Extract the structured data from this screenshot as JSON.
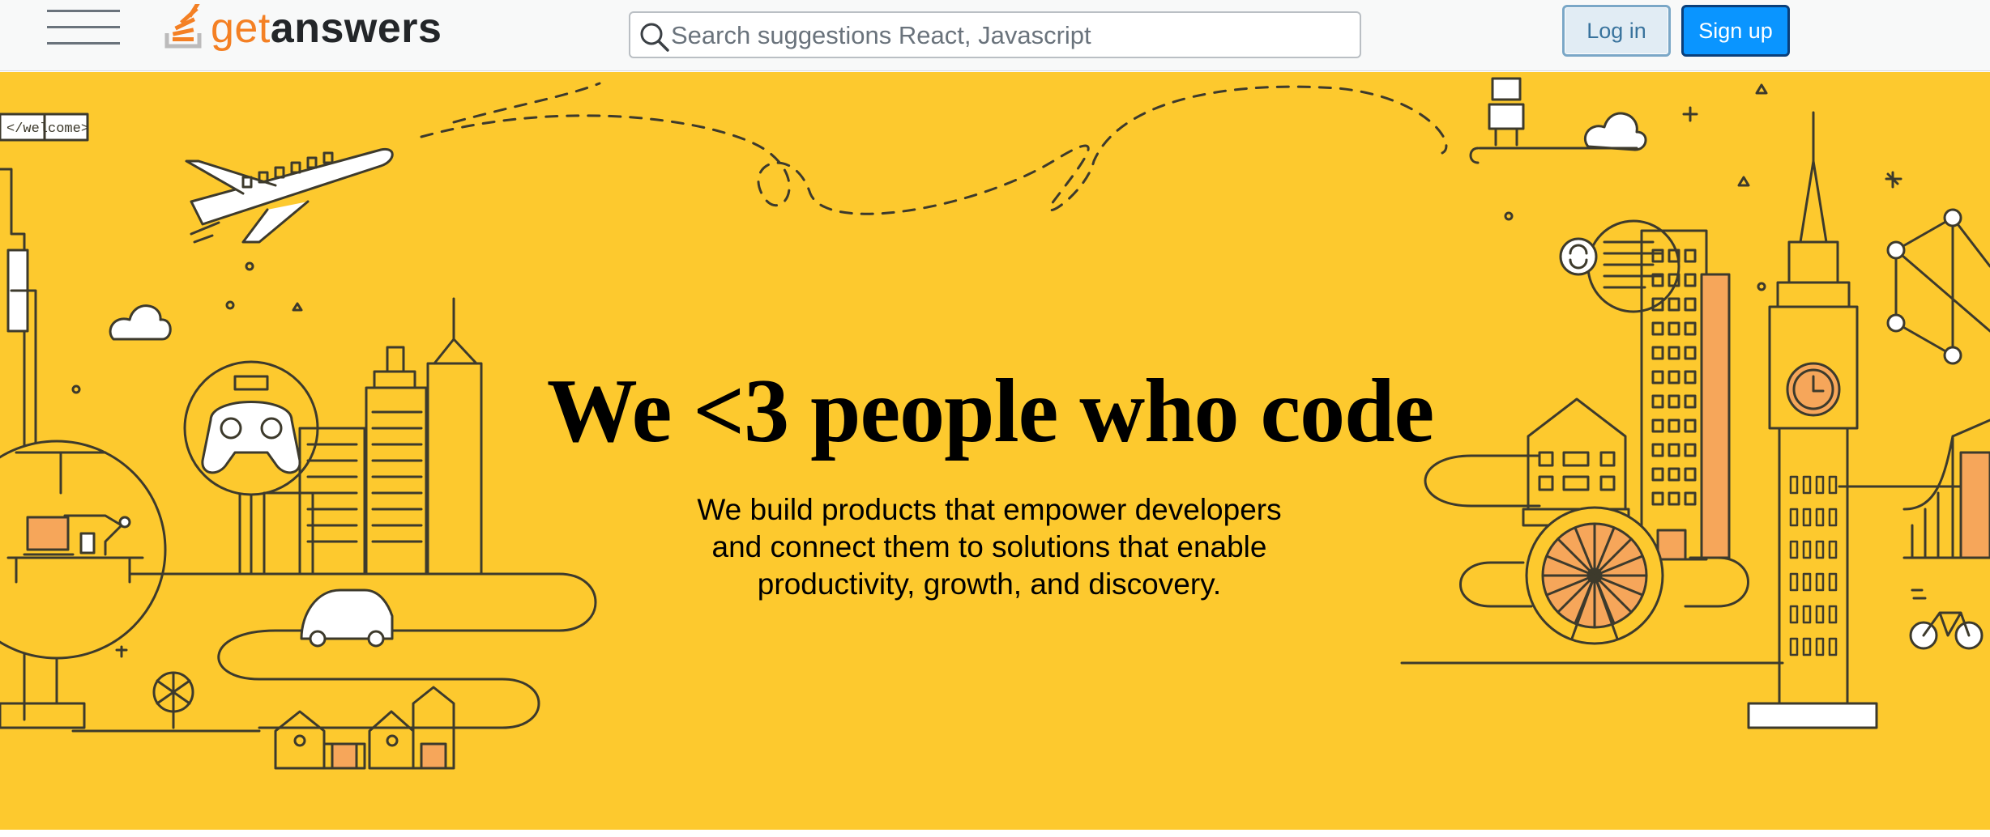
{
  "header": {
    "brand_prefix": "get",
    "brand_suffix": "answers",
    "search": {
      "placeholder": "Search suggestions React, Javascript"
    },
    "login_label": "Log in",
    "signup_label": "Sign up"
  },
  "hero": {
    "title": "We <3 people who code",
    "subtitle": "We build products that empower developers and connect them to solutions that enable productivity, growth, and discovery.",
    "welcome_sign": "</welcome>"
  },
  "icons": {
    "menu": "hamburger-menu-icon",
    "logo": "stack-logo-icon",
    "search": "search-icon"
  },
  "colors": {
    "hero_background": "#fdc92e",
    "brand_orange": "#f48024",
    "primary_button": "#0a95ff",
    "secondary_button": "#e1ecf4",
    "line_art": "#3d3a2c"
  }
}
